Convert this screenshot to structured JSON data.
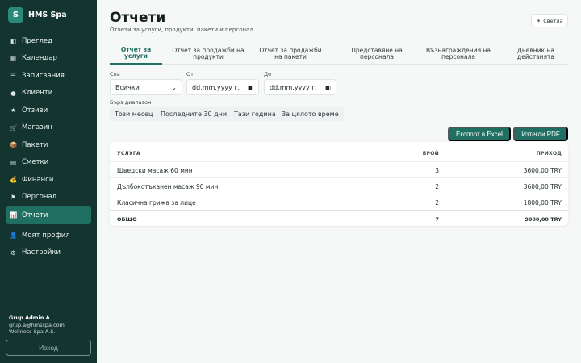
{
  "sidebar": {
    "brand_letter": "S",
    "brand_name": "HMS Spa",
    "items": [
      {
        "label": "Преглед",
        "icon": "◧"
      },
      {
        "label": "Календар",
        "icon": "▦"
      },
      {
        "label": "Записвания",
        "icon": "☰"
      },
      {
        "label": "Клиенти",
        "icon": "●"
      },
      {
        "label": "Отзиви",
        "icon": "★"
      },
      {
        "label": "Магазин",
        "icon": "🛒"
      },
      {
        "label": "Пакети",
        "icon": "📦"
      },
      {
        "label": "Сметки",
        "icon": "▤"
      },
      {
        "label": "Финанси",
        "icon": "💰"
      },
      {
        "label": "Персонал",
        "icon": "⚑"
      },
      {
        "label": "Отчети",
        "icon": "📊"
      },
      {
        "label": "Моят профил",
        "icon": "👤"
      },
      {
        "label": "Настройки",
        "icon": "⚙"
      }
    ],
    "user_name": "Grup Admin A",
    "user_email": "grup.a@hmsspa.com",
    "user_company": "Wellness Spa A.Ş.",
    "logout_label": "Изход"
  },
  "header": {
    "title": "Отчети",
    "subtitle": "Отчети за услуги, продукти, пакети и персонал",
    "theme_icon": "☀",
    "theme_label": "Светла"
  },
  "tabs": [
    "Отчет за услуги",
    "Отчет за продажби на продукти",
    "Отчет за продажби на пакети",
    "Представяне на персонала",
    "Възнаграждения на персонала",
    "Дневник на действията"
  ],
  "filters": {
    "spa_label": "Спа",
    "spa_value": "Всички",
    "from_label": "От",
    "from_placeholder": "dd.mm.yyyy г.",
    "to_label": "До",
    "to_placeholder": "dd.mm.yyyy г.",
    "quick_label": "Бърз диапазон",
    "quick_ranges": [
      "Този месец",
      "Последните 30 дни",
      "Тази година",
      "За цялото време"
    ]
  },
  "actions": {
    "export_excel": "Експорт в Excel",
    "download_pdf": "Изтегли PDF"
  },
  "table": {
    "headers": {
      "service": "УСЛУГА",
      "count": "БРОЙ",
      "revenue": "ПРИХОД"
    },
    "rows": [
      {
        "service": "Шведски масаж 60 мин",
        "count": "3",
        "revenue": "3600,00 TRY"
      },
      {
        "service": "Дълбокотъканен масаж 90 мин",
        "count": "2",
        "revenue": "3600,00 TRY"
      },
      {
        "service": "Класична грижа за лице",
        "count": "2",
        "revenue": "1800,00 TRY"
      }
    ],
    "total": {
      "label": "ОБЩО",
      "count": "7",
      "revenue": "9000,00 TRY"
    }
  },
  "colors": {
    "sidebar_bg": "#143430",
    "accent": "#1f6f62",
    "page_bg": "#f6f7f7"
  }
}
